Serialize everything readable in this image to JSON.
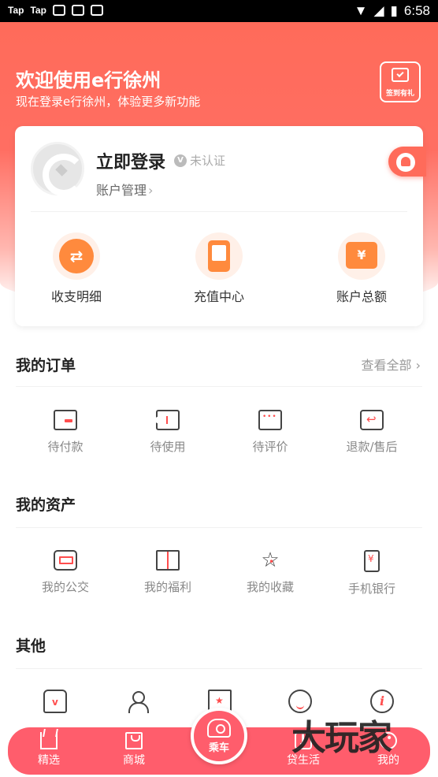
{
  "status_bar": {
    "left_apps": [
      "Tap",
      "Tap"
    ],
    "time": "6:58"
  },
  "header": {
    "title": "欢迎使用e行徐州",
    "subtitle": "现在登录e行徐州，体验更多新功能",
    "signin_label": "签到有礼",
    "signin_icon": "calendar-check-icon"
  },
  "account": {
    "login_title": "立即登录",
    "verify_status": "未认证",
    "account_manage": "账户管理",
    "notification_icon": "bell-icon",
    "quick_actions": [
      {
        "label": "收支明细",
        "icon": "exchange-icon"
      },
      {
        "label": "充值中心",
        "icon": "phone-card-icon"
      },
      {
        "label": "账户总额",
        "icon": "wallet-yen-icon"
      }
    ]
  },
  "orders": {
    "title": "我的订单",
    "view_all": "查看全部",
    "items": [
      {
        "label": "待付款",
        "icon": "card-icon"
      },
      {
        "label": "待使用",
        "icon": "ticket-icon"
      },
      {
        "label": "待评价",
        "icon": "comment-icon"
      },
      {
        "label": "退款/售后",
        "icon": "refund-icon"
      }
    ]
  },
  "assets": {
    "title": "我的资产",
    "items": [
      {
        "label": "我的公交",
        "icon": "bus-icon"
      },
      {
        "label": "我的福利",
        "icon": "gift-icon"
      },
      {
        "label": "我的收藏",
        "icon": "star-icon"
      },
      {
        "label": "手机银行",
        "icon": "mobile-bank-icon"
      }
    ]
  },
  "other": {
    "title": "其他",
    "icons": [
      "store-icon",
      "person-icon",
      "book-icon",
      "headset-icon",
      "info-icon"
    ]
  },
  "tabbar": {
    "items": [
      {
        "label": "精选",
        "icon": "crown-icon"
      },
      {
        "label": "商城",
        "icon": "shopping-bag-icon"
      },
      {
        "label": "乘车",
        "icon": "bus-ride-icon"
      },
      {
        "label": "贷生活",
        "icon": "loan-icon"
      },
      {
        "label": "我的",
        "icon": "profile-icon"
      }
    ]
  },
  "watermark": "大玩家",
  "colors": {
    "brand": "#ff6b5a",
    "tabbar": "#ff5d6c",
    "accent_orange": "#ff8a3d"
  }
}
